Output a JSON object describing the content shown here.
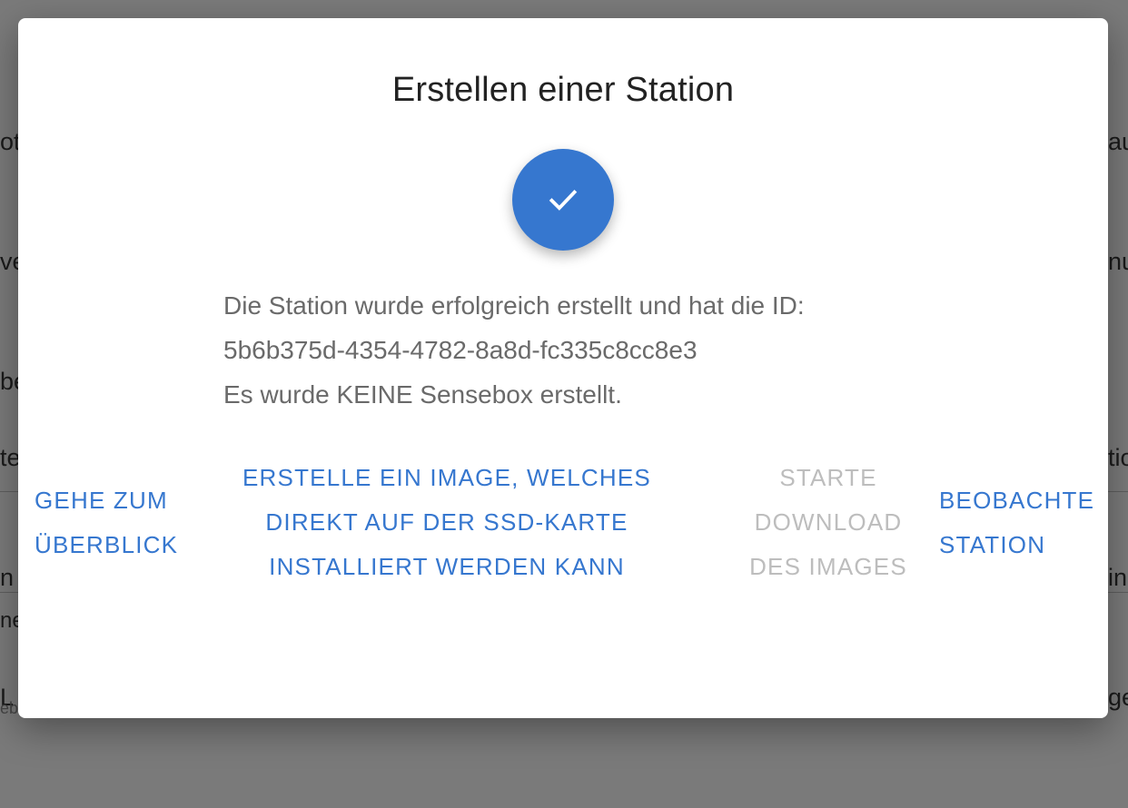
{
  "dialog": {
    "title": "Erstellen einer Station",
    "icon": "checkmark-icon",
    "accent_color": "#3677cf",
    "message": {
      "line1": "Die Station wurde erfolgreich erstellt und hat die ID:",
      "station_id": "5b6b375d-4354-4782-8a8d-fc335c8cc8e3",
      "line3": "Es wurde KEINE Sensebox erstellt."
    },
    "actions": {
      "overview": [
        "GEHE ZUM",
        "ÜBERBLICK"
      ],
      "create_image": [
        "ERSTELLE EIN IMAGE, WELCHES",
        "DIREKT AUF DER SSD-KARTE",
        "INSTALLIERT WERDEN KANN"
      ],
      "download_image": [
        "STARTE",
        "DOWNLOAD",
        "DES IMAGES"
      ],
      "observe_station": [
        "BEOBACHTE",
        "STATION"
      ]
    }
  },
  "background": {
    "left_fragments_top": [
      "ot",
      "ve",
      "be"
    ],
    "left_fragments_mid": [
      "te",
      "n",
      "L"
    ],
    "right_fragments_top": [
      "au",
      "nu"
    ],
    "right_fragments_mid": [
      "tio",
      "in",
      "ge"
    ],
    "left_fragment_row": "ne",
    "left_fragment_small": "eb"
  }
}
